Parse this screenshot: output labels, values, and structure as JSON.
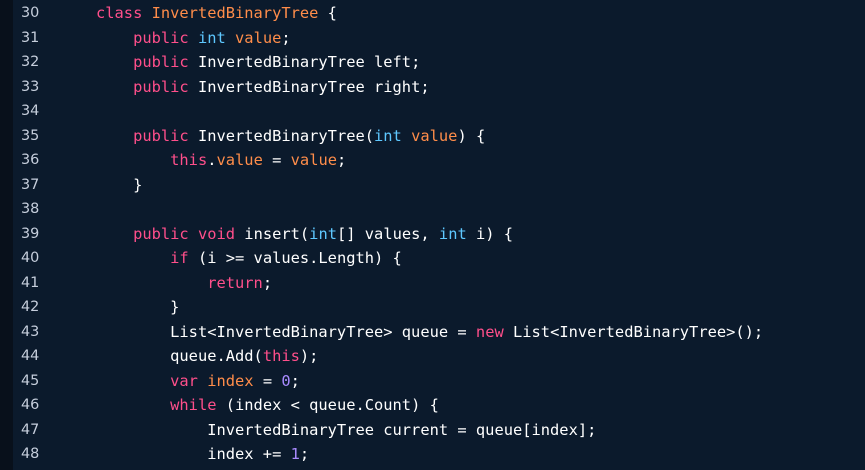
{
  "editor": {
    "lines": [
      {
        "number": "30",
        "indent": 0,
        "tokens": [
          {
            "text": "class ",
            "kind": "kw"
          },
          {
            "text": "InvertedBinaryTree",
            "kind": "cls"
          },
          {
            "text": " {",
            "kind": "plain"
          }
        ]
      },
      {
        "number": "31",
        "indent": 1,
        "tokens": [
          {
            "text": "public ",
            "kind": "kw"
          },
          {
            "text": "int ",
            "kind": "type"
          },
          {
            "text": "value",
            "kind": "name"
          },
          {
            "text": ";",
            "kind": "plain"
          }
        ]
      },
      {
        "number": "32",
        "indent": 1,
        "tokens": [
          {
            "text": "public ",
            "kind": "kw"
          },
          {
            "text": "InvertedBinaryTree left;",
            "kind": "plain"
          }
        ]
      },
      {
        "number": "33",
        "indent": 1,
        "tokens": [
          {
            "text": "public ",
            "kind": "kw"
          },
          {
            "text": "InvertedBinaryTree right;",
            "kind": "plain"
          }
        ]
      },
      {
        "number": "34",
        "indent": 0,
        "tokens": []
      },
      {
        "number": "35",
        "indent": 1,
        "tokens": [
          {
            "text": "public ",
            "kind": "kw"
          },
          {
            "text": "InvertedBinaryTree(",
            "kind": "plain"
          },
          {
            "text": "int ",
            "kind": "type"
          },
          {
            "text": "value",
            "kind": "name"
          },
          {
            "text": ") {",
            "kind": "plain"
          }
        ]
      },
      {
        "number": "36",
        "indent": 2,
        "tokens": [
          {
            "text": "this",
            "kind": "kw"
          },
          {
            "text": ".",
            "kind": "plain"
          },
          {
            "text": "value",
            "kind": "name"
          },
          {
            "text": " = ",
            "kind": "plain"
          },
          {
            "text": "value",
            "kind": "name"
          },
          {
            "text": ";",
            "kind": "plain"
          }
        ]
      },
      {
        "number": "37",
        "indent": 1,
        "tokens": [
          {
            "text": "}",
            "kind": "plain"
          }
        ]
      },
      {
        "number": "38",
        "indent": 0,
        "tokens": []
      },
      {
        "number": "39",
        "indent": 1,
        "tokens": [
          {
            "text": "public ",
            "kind": "kw"
          },
          {
            "text": "void ",
            "kind": "kw"
          },
          {
            "text": "insert(",
            "kind": "plain"
          },
          {
            "text": "int",
            "kind": "type"
          },
          {
            "text": "[] values, ",
            "kind": "plain"
          },
          {
            "text": "int ",
            "kind": "type"
          },
          {
            "text": "i) {",
            "kind": "plain"
          }
        ]
      },
      {
        "number": "40",
        "indent": 2,
        "tokens": [
          {
            "text": "if ",
            "kind": "kw"
          },
          {
            "text": "(i >= values.Length) {",
            "kind": "plain"
          }
        ]
      },
      {
        "number": "41",
        "indent": 3,
        "tokens": [
          {
            "text": "return",
            "kind": "kw"
          },
          {
            "text": ";",
            "kind": "plain"
          }
        ]
      },
      {
        "number": "42",
        "indent": 2,
        "tokens": [
          {
            "text": "}",
            "kind": "plain"
          }
        ]
      },
      {
        "number": "43",
        "indent": 2,
        "tokens": [
          {
            "text": "List<InvertedBinaryTree> queue = ",
            "kind": "plain"
          },
          {
            "text": "new ",
            "kind": "kw"
          },
          {
            "text": "List<InvertedBinaryTree>();",
            "kind": "plain"
          }
        ]
      },
      {
        "number": "44",
        "indent": 2,
        "tokens": [
          {
            "text": "queue.Add(",
            "kind": "plain"
          },
          {
            "text": "this",
            "kind": "kw"
          },
          {
            "text": ");",
            "kind": "plain"
          }
        ]
      },
      {
        "number": "45",
        "indent": 2,
        "tokens": [
          {
            "text": "var ",
            "kind": "kw"
          },
          {
            "text": "index",
            "kind": "name"
          },
          {
            "text": " = ",
            "kind": "plain"
          },
          {
            "text": "0",
            "kind": "num"
          },
          {
            "text": ";",
            "kind": "plain"
          }
        ]
      },
      {
        "number": "46",
        "indent": 2,
        "tokens": [
          {
            "text": "while ",
            "kind": "kw"
          },
          {
            "text": "(index < queue.Count) {",
            "kind": "plain"
          }
        ]
      },
      {
        "number": "47",
        "indent": 3,
        "tokens": [
          {
            "text": "InvertedBinaryTree current = queue[index];",
            "kind": "plain"
          }
        ]
      },
      {
        "number": "48",
        "indent": 3,
        "tokens": [
          {
            "text": "index += ",
            "kind": "plain"
          },
          {
            "text": "1",
            "kind": "num"
          },
          {
            "text": ";",
            "kind": "plain"
          }
        ]
      }
    ]
  },
  "colors": {
    "background": "#0b1a2c",
    "keyword": "#ff4f8b",
    "type": "#5ec8ff",
    "class_name": "#ff8d4a",
    "number": "#a98bff",
    "text": "#ffffff",
    "line_number": "#d6deeb"
  }
}
